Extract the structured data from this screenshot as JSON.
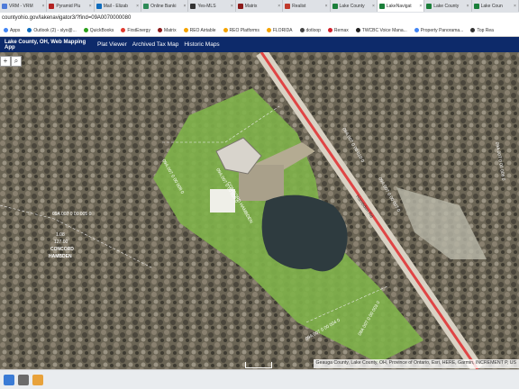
{
  "browser": {
    "tabs": [
      {
        "label": "VRM - VRM",
        "color": "#4e7bd9"
      },
      {
        "label": "Pyramid Plu",
        "color": "#b22222"
      },
      {
        "label": "Mail - Elizab",
        "color": "#0f6cbd"
      },
      {
        "label": "Online Banki",
        "color": "#2e8b57"
      },
      {
        "label": "Yes-MLS",
        "color": "#333333"
      },
      {
        "label": "Matrix",
        "color": "#8b1a1a"
      },
      {
        "label": "Realist",
        "color": "#c0392b"
      },
      {
        "label": "Lake County",
        "color": "#1b7f3a"
      },
      {
        "label": "LakeNavigat",
        "color": "#1b7f3a"
      },
      {
        "label": "Lake County",
        "color": "#1b7f3a"
      },
      {
        "label": "Lake Coun",
        "color": "#1b7f3a"
      }
    ],
    "url": "countyohio.gov/lakenavigator3/?find=09A0070000080",
    "bookmarks": [
      {
        "label": "Apps",
        "color": "#4285f4"
      },
      {
        "label": "Outlook (2) - slyo@...",
        "color": "#0f6cbd"
      },
      {
        "label": "QuickBooks",
        "color": "#2ca01c"
      },
      {
        "label": "FirstEnergy",
        "color": "#e03c31"
      },
      {
        "label": "Matrix",
        "color": "#8b1a1a"
      },
      {
        "label": "REO Airtable",
        "color": "#f4a300"
      },
      {
        "label": "REO Platforms",
        "color": "#f4a300"
      },
      {
        "label": "FLORIDA",
        "color": "#f4a300"
      },
      {
        "label": "dotloop",
        "color": "#444444"
      },
      {
        "label": "Remax",
        "color": "#d0202a"
      },
      {
        "label": "TWCBC Voice Mana...",
        "color": "#222222"
      },
      {
        "label": "Property Panorama...",
        "color": "#4285f4"
      },
      {
        "label": "Top Rea",
        "color": "#333333"
      }
    ]
  },
  "app": {
    "title": "Lake County, OH, Web Mapping App",
    "menu": [
      "Plat Viewer",
      "Archived Tax Map",
      "Historic Maps"
    ]
  },
  "map": {
    "parcel_labels": [
      "09A 007 0 00 008 0",
      "09A 007 0 00 009 0",
      "CONCORD HAMBDEN",
      "09A 007 0 00 010 0",
      "09A 007 0 00 007 0",
      "09A 007 0 00 006 0",
      "09A 007 0 00 005 0",
      "127.00",
      "1.08",
      "CONCORD",
      "HAMBDEN",
      "09A 007 0 00 004 0",
      "09A 007 0 00 003 0",
      "Hambden Rd"
    ],
    "attribution": "Geauga County, Lake County, OH, Province of Ontario, Esri, HERE, Garmin, INCREMENT P, US"
  }
}
